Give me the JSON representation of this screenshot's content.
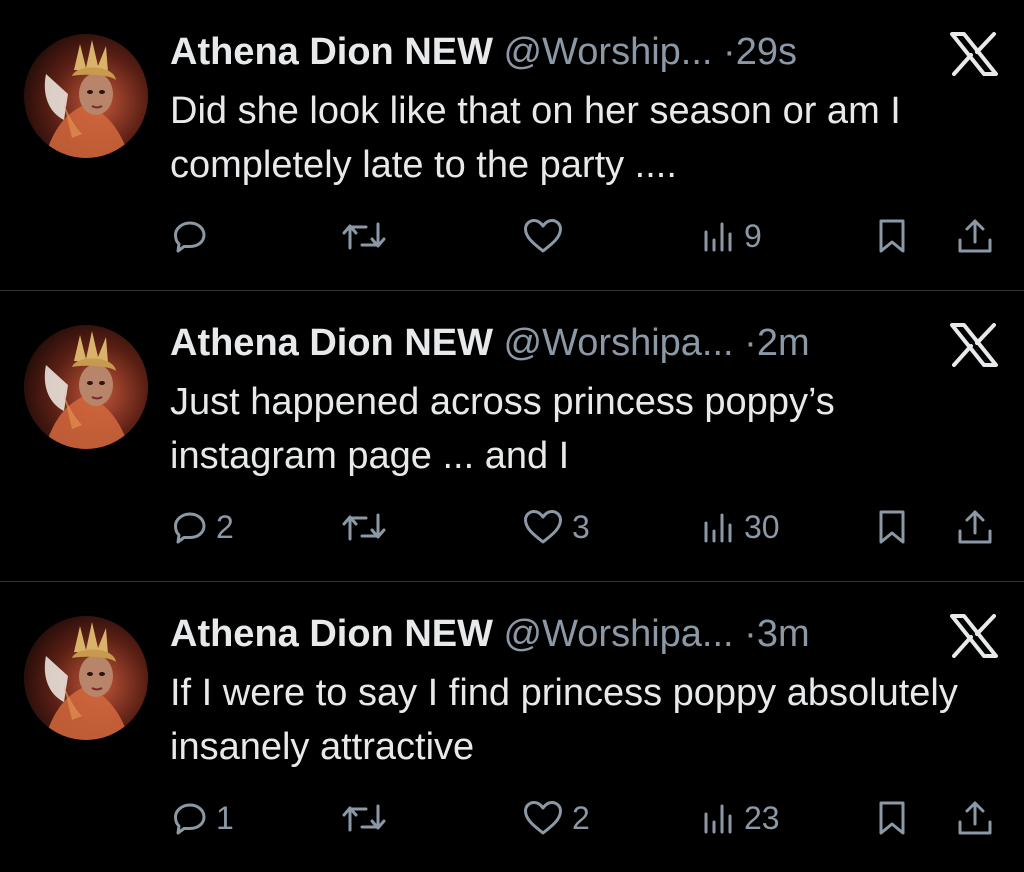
{
  "tweets": [
    {
      "name": "Athena Dion NEW",
      "handle": "@Worship...",
      "separator": "·",
      "time": "29s",
      "text": "Did she look like that on her season or am I completely late to the party ....",
      "replies": "",
      "retweets": "",
      "likes": "",
      "views": "9"
    },
    {
      "name": "Athena Dion NEW",
      "handle": "@Worshipa...",
      "separator": "·",
      "time": "2m",
      "text": "Just happened across princess poppy’s instagram page ... and I",
      "replies": "2",
      "retweets": "",
      "likes": "3",
      "views": "30"
    },
    {
      "name": "Athena Dion NEW",
      "handle": "@Worshipa...",
      "separator": "·",
      "time": "3m",
      "text": "If I were to say I find princess poppy absolutely insanely attractive",
      "replies": "1",
      "retweets": "",
      "likes": "2",
      "views": "23"
    }
  ],
  "colors": {
    "background": "#000000",
    "text_primary": "#e7e9ea",
    "text_secondary": "#8b98a5",
    "divider": "#2f3336"
  },
  "icons": [
    "reply-icon",
    "retweet-icon",
    "like-icon",
    "views-icon",
    "bookmark-icon",
    "share-icon",
    "x-logo-icon"
  ]
}
